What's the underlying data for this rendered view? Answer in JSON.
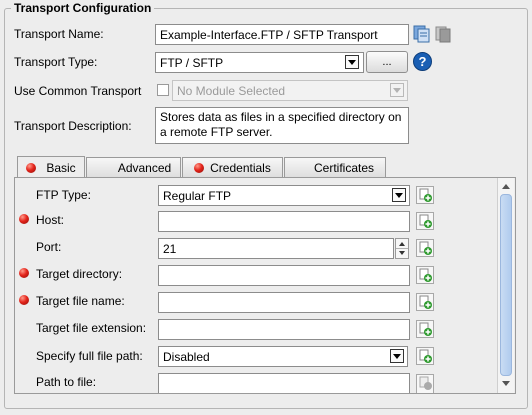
{
  "section": {
    "title": "Transport Configuration"
  },
  "transport_name": {
    "label": "Transport Name:",
    "value": "Example-Interface.FTP / SFTP Transport"
  },
  "transport_type": {
    "label": "Transport Type:",
    "value": "FTP / SFTP",
    "browse_label": "..."
  },
  "common_transport": {
    "label": "Use Common Transport",
    "value": "No Module Selected"
  },
  "description": {
    "label": "Transport Description:",
    "value": "Stores data as files in a specified directory on a remote FTP server."
  },
  "tabs": [
    {
      "label": "Basic"
    },
    {
      "label": "Advanced"
    },
    {
      "label": "Credentials"
    },
    {
      "label": "Certificates"
    }
  ],
  "fields": {
    "ftp_type": {
      "label": "FTP Type:",
      "value": "Regular FTP"
    },
    "host": {
      "label": "Host:",
      "value": ""
    },
    "port": {
      "label": "Port:",
      "value": "21"
    },
    "target_dir": {
      "label": "Target directory:",
      "value": ""
    },
    "target_file": {
      "label": "Target file name:",
      "value": ""
    },
    "target_ext": {
      "label": "Target file extension:",
      "value": ""
    },
    "full_path": {
      "label": "Specify full file path:",
      "value": "Disabled"
    },
    "path_to_file": {
      "label": "Path to file:",
      "value": ""
    }
  },
  "colors": {
    "required_dot": "#e4241b",
    "help_blue": "#1a5fb4",
    "scroll_thumb": "#b0cbee"
  }
}
